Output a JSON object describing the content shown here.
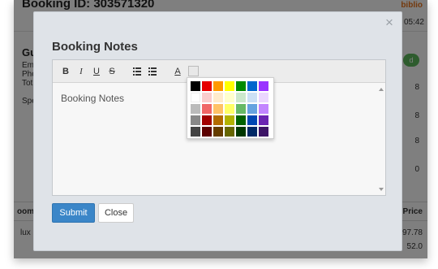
{
  "background": {
    "title": "Booking ID: 303571320",
    "logo": "biblio",
    "time": "05:42",
    "guest_heading": "Gu",
    "lines": [
      "Em",
      "Pho",
      "Tot",
      "Spe"
    ],
    "badge": "d",
    "side_numbers": [
      "8",
      "8",
      "8",
      "0"
    ],
    "table_head_left": "oom",
    "table_head_right": "Price",
    "row1_left": "lux",
    "row1_right": "97.78",
    "row2_right": "52.0"
  },
  "modal": {
    "title": "Booking Notes",
    "close_glyph": "×",
    "editor": {
      "placeholder": "Booking Notes",
      "toolbar": {
        "bold": "B",
        "italic": "I",
        "underline": "U",
        "strike": "S",
        "font_color": "A"
      },
      "palette_colors": [
        [
          "#000000",
          "#e60000",
          "#ff9900",
          "#ffff00",
          "#008a00",
          "#0066cc",
          "#9933ff"
        ],
        [
          "#ffffff",
          "#facccc",
          "#ffebcc",
          "#ffffcc",
          "#cce8cc",
          "#cce0f5",
          "#ebd6ff"
        ],
        [
          "#bbbbbb",
          "#f06666",
          "#ffc266",
          "#ffff66",
          "#66b966",
          "#66a3e0",
          "#c285ff"
        ],
        [
          "#888888",
          "#a10000",
          "#b26b00",
          "#b2b200",
          "#006100",
          "#0047b2",
          "#6b24b2"
        ],
        [
          "#444444",
          "#5c0000",
          "#663d00",
          "#666600",
          "#003700",
          "#002966",
          "#3d1466"
        ]
      ]
    },
    "buttons": {
      "submit": "Submit",
      "close": "Close"
    }
  }
}
